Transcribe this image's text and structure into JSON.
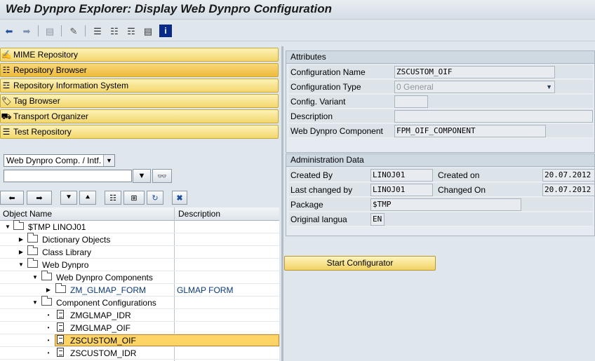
{
  "window": {
    "title": "Web Dynpro Explorer: Display Web Dynpro Configuration"
  },
  "toolbar": {
    "icons": [
      "back-arrow-icon",
      "forward-arrow-icon",
      "other-object-icon",
      "display-change-icon",
      "hierarchy-icon",
      "tree-structure-icon",
      "where-used-icon",
      "display-object-list-icon",
      "information-icon"
    ]
  },
  "nav": {
    "items": [
      {
        "label": "MIME Repository",
        "icon": "mime-icon"
      },
      {
        "label": "Repository Browser",
        "icon": "repository-icon"
      },
      {
        "label": "Repository Information System",
        "icon": "info-system-icon"
      },
      {
        "label": "Tag Browser",
        "icon": "tag-icon"
      },
      {
        "label": "Transport Organizer",
        "icon": "truck-icon"
      },
      {
        "label": "Test Repository",
        "icon": "test-icon"
      }
    ],
    "active_index": 1
  },
  "browser": {
    "object_type": "Web Dynpro Comp. / Intf.",
    "object_name": ""
  },
  "tree": {
    "columns": {
      "name": "Object Name",
      "description": "Description"
    },
    "rows": [
      {
        "label": "$TMP LINOJ01",
        "description": ""
      },
      {
        "label": "Dictionary Objects",
        "description": ""
      },
      {
        "label": "Class Library",
        "description": ""
      },
      {
        "label": "Web Dynpro",
        "description": ""
      },
      {
        "label": "Web Dynpro Components",
        "description": ""
      },
      {
        "label": "ZM_GLMAP_FORM",
        "description": "GLMAP FORM"
      },
      {
        "label": "Component Configurations",
        "description": ""
      },
      {
        "label": "ZMGLMAP_IDR",
        "description": ""
      },
      {
        "label": "ZMGLMAP_OIF",
        "description": ""
      },
      {
        "label": "ZSCUSTOM_OIF",
        "description": ""
      },
      {
        "label": "ZSCUSTOM_IDR",
        "description": ""
      }
    ]
  },
  "attributes": {
    "title": "Attributes",
    "fields": [
      {
        "label": "Configuration Name",
        "value": "ZSCUSTOM_OIF"
      },
      {
        "label": "Configuration Type",
        "value": "0 General"
      },
      {
        "label": "Config. Variant",
        "value": ""
      },
      {
        "label": "Description",
        "value": ""
      },
      {
        "label": "Web Dynpro Component",
        "value": "FPM_OIF_COMPONENT"
      }
    ]
  },
  "admin": {
    "title": "Administration Data",
    "created_by_label": "Created By",
    "created_by": "LINOJ01",
    "created_on_label": "Created on",
    "created_on": "20.07.2012",
    "changed_by_label": "Last changed by",
    "changed_by": "LINOJ01",
    "changed_on_label": "Changed On",
    "changed_on": "20.07.2012",
    "package_label": "Package",
    "package": "$TMP",
    "lang_label": "Original langua",
    "lang": "EN"
  },
  "actions": {
    "start_configurator": "Start Configurator"
  }
}
